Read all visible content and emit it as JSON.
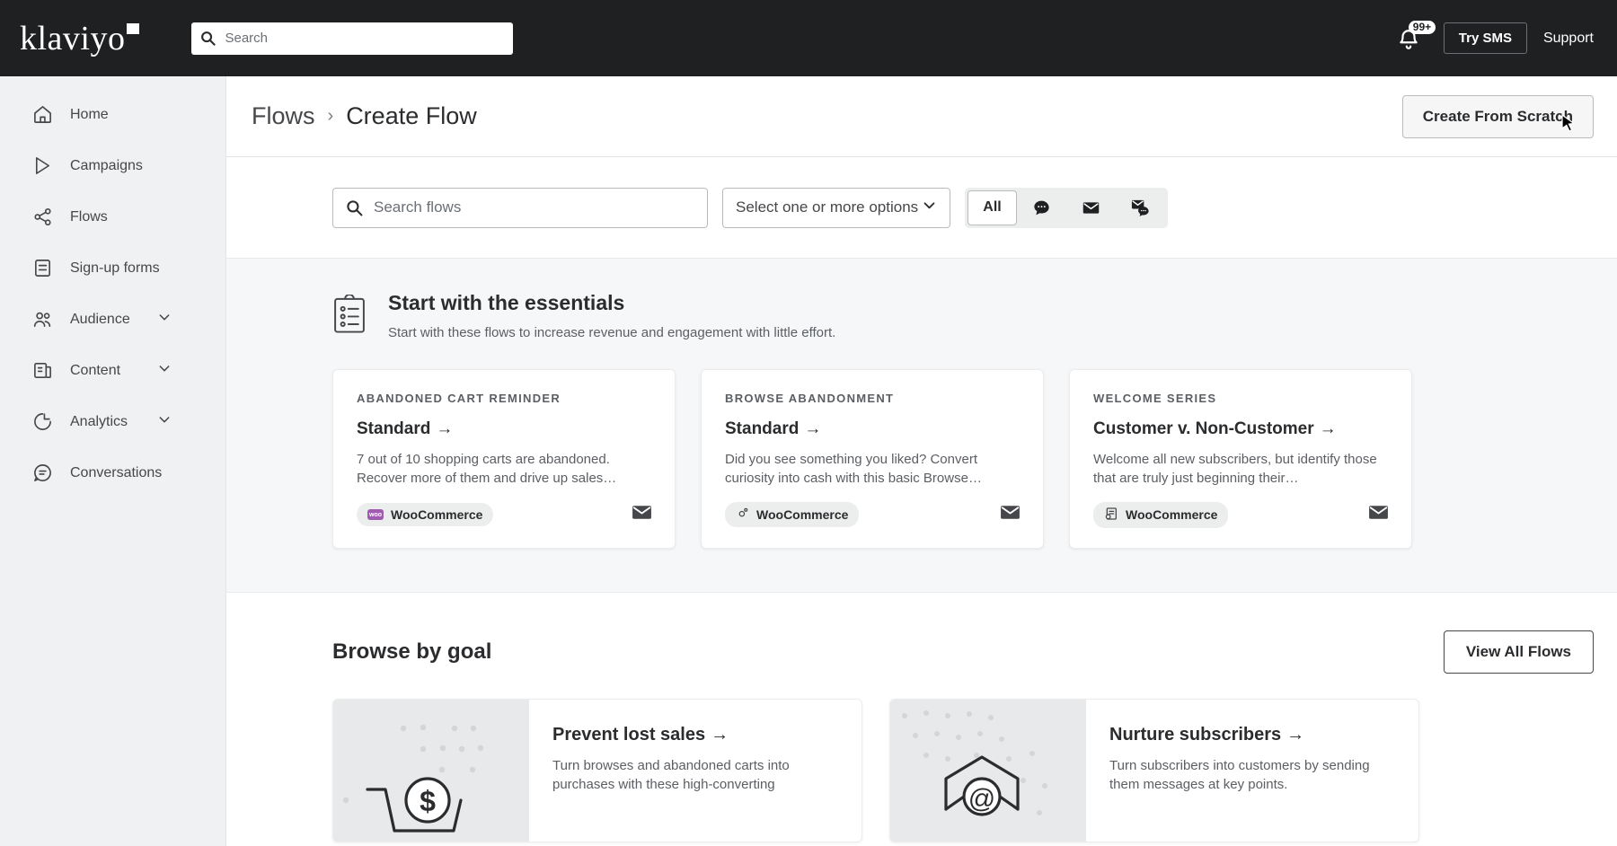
{
  "topbar": {
    "logo_text": "klaviyo",
    "search_placeholder": "Search",
    "notifications_badge": "99+",
    "try_sms_label": "Try SMS",
    "support_label": "Support"
  },
  "sidebar": {
    "items": [
      {
        "label": "Home",
        "icon": "home-icon",
        "expandable": false
      },
      {
        "label": "Campaigns",
        "icon": "campaigns-icon",
        "expandable": false
      },
      {
        "label": "Flows",
        "icon": "flows-icon",
        "expandable": false
      },
      {
        "label": "Sign-up forms",
        "icon": "signup-forms-icon",
        "expandable": false
      },
      {
        "label": "Audience",
        "icon": "audience-icon",
        "expandable": true
      },
      {
        "label": "Content",
        "icon": "content-icon",
        "expandable": true
      },
      {
        "label": "Analytics",
        "icon": "analytics-icon",
        "expandable": true
      },
      {
        "label": "Conversations",
        "icon": "conversations-icon",
        "expandable": false
      }
    ]
  },
  "page_header": {
    "breadcrumb_parent": "Flows",
    "breadcrumb_separator": "›",
    "breadcrumb_current": "Create Flow",
    "create_from_scratch_label": "Create From Scratch"
  },
  "filters": {
    "search_placeholder": "Search flows",
    "select_value": "Select one or more options",
    "segments": [
      {
        "label": "All",
        "icon": "",
        "active": true
      },
      {
        "label": "",
        "icon": "sms-bubble-icon",
        "active": false
      },
      {
        "label": "",
        "icon": "email-envelope-icon",
        "active": false
      },
      {
        "label": "",
        "icon": "email-and-sms-icon",
        "active": false
      }
    ]
  },
  "essentials": {
    "icon": "clipboard-checklist-icon",
    "title": "Start with the essentials",
    "subtitle": "Start with these flows to increase revenue and engagement with little effort.",
    "cards": [
      {
        "eyebrow": "ABANDONED CART REMINDER",
        "title": "Standard",
        "arrow": "→",
        "description": "7 out of 10 shopping carts are abandoned. Recover more of them and drive up sales…",
        "integration": "WooCommerce",
        "integration_icon": "woocommerce-logo-icon",
        "channel_icon": "email-envelope-icon"
      },
      {
        "eyebrow": "BROWSE ABANDONMENT",
        "title": "Standard",
        "arrow": "→",
        "description": "Did you see something you liked? Convert curiosity into cash with this basic Browse…",
        "integration": "WooCommerce",
        "integration_icon": "gear-icon",
        "channel_icon": "email-envelope-icon"
      },
      {
        "eyebrow": "WELCOME SERIES",
        "title": "Customer v. Non-Customer",
        "arrow": "→",
        "description": "Welcome all new subscribers, but identify those that are truly just beginning their…",
        "integration": "WooCommerce",
        "integration_icon": "document-clock-icon",
        "channel_icon": "email-envelope-icon"
      }
    ]
  },
  "goals": {
    "title": "Browse by goal",
    "view_all_label": "View All Flows",
    "cards": [
      {
        "title": "Prevent lost sales",
        "arrow": "→",
        "description": "Turn browses and abandoned carts into purchases with these high-converting",
        "thumb_icon": "cart-with-dollar-icon"
      },
      {
        "title": "Nurture subscribers",
        "arrow": "→",
        "description": "Turn subscribers into customers by sending them messages at key points.",
        "thumb_icon": "envelope-with-at-sign-icon"
      }
    ]
  },
  "colors": {
    "topbar_bg": "#1f2022",
    "sidebar_bg": "#f0f1f2",
    "essentials_bg": "#f6f7f8",
    "woocommerce_purple": "#a05bb0",
    "text_primary": "#2b2c2e",
    "text_secondary": "#5b5e63"
  }
}
